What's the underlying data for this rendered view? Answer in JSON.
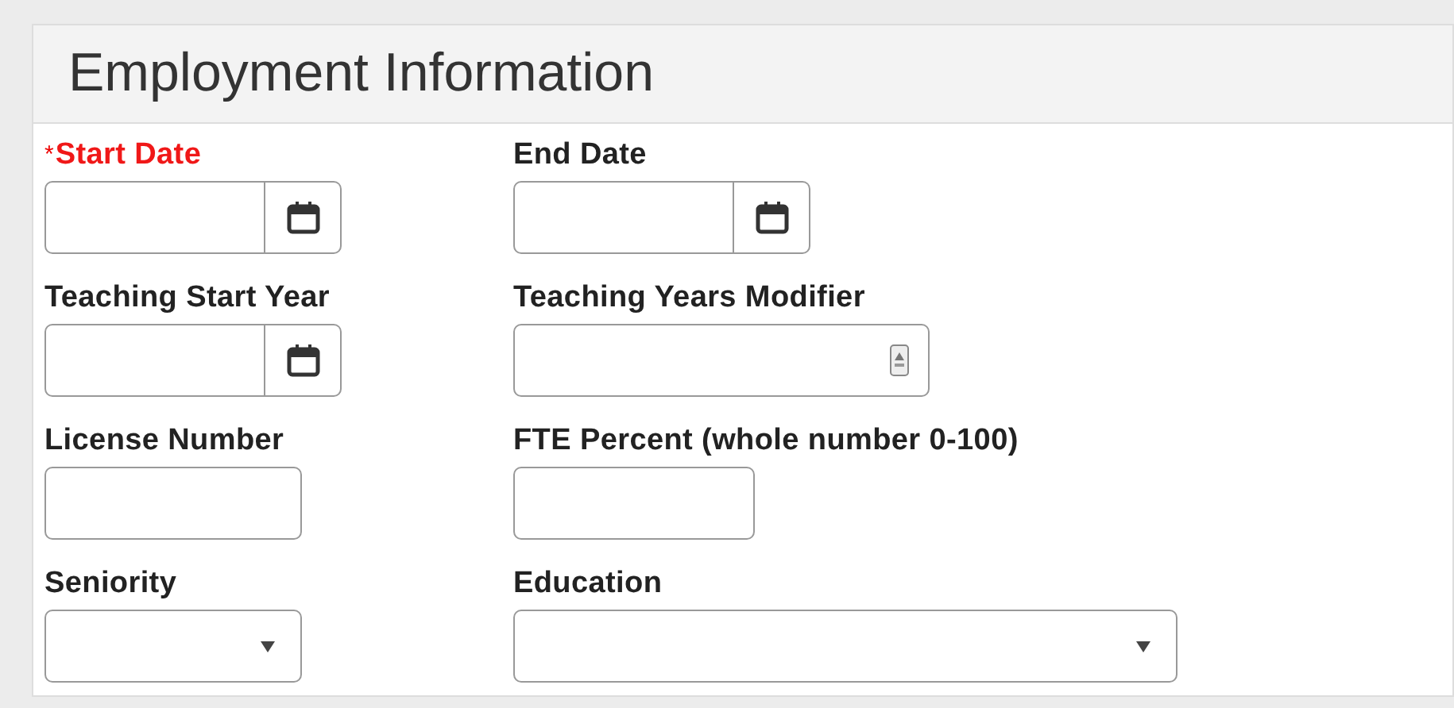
{
  "section": {
    "title": "Employment Information"
  },
  "rows": [
    [
      {
        "label": "Start Date",
        "required": true,
        "required_mark": "*",
        "kind": "date"
      },
      {
        "label": "End Date",
        "required": false,
        "kind": "date"
      }
    ],
    [
      {
        "label": "Teaching Start Year",
        "required": false,
        "kind": "date"
      },
      {
        "label": "Teaching Years Modifier",
        "required": false,
        "kind": "number"
      }
    ],
    [
      {
        "label": "License Number",
        "required": false,
        "kind": "text"
      },
      {
        "label": "FTE Percent (whole number 0-100)",
        "required": false,
        "kind": "text"
      }
    ],
    [
      {
        "label": "Seniority",
        "required": false,
        "kind": "select"
      },
      {
        "label": "Education",
        "required": false,
        "kind": "select-wide"
      }
    ]
  ]
}
